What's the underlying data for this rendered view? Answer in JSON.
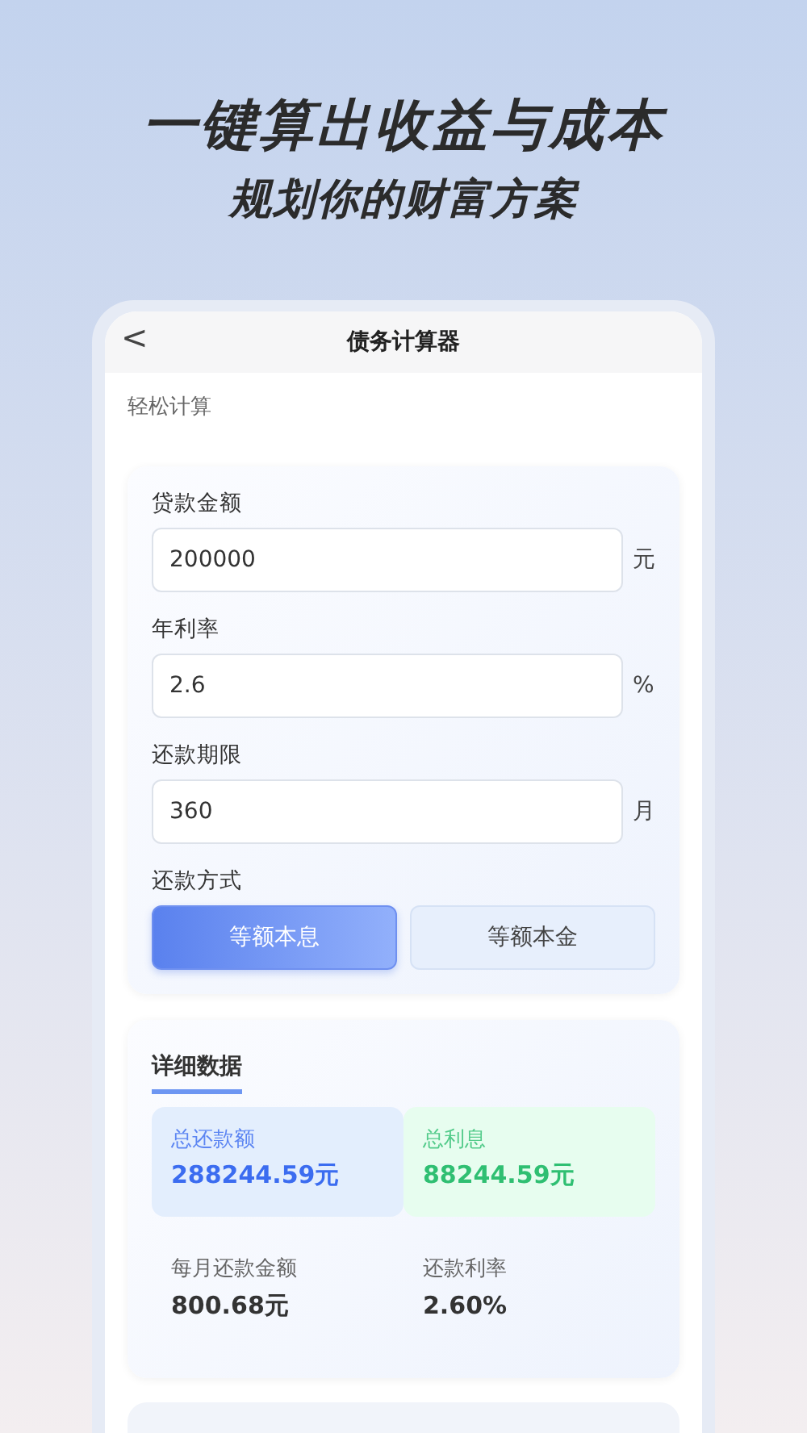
{
  "headline": "一键算出收益与成本",
  "subheadline": "规划你的财富方案",
  "screen": {
    "back": "<",
    "title": "债务计算器",
    "subtitle": "轻松计算"
  },
  "fields": [
    {
      "label": "贷款金额",
      "value": "200000",
      "unit": "元"
    },
    {
      "label": "年利率",
      "value": "2.6",
      "unit": "%"
    },
    {
      "label": "还款期限",
      "value": "360",
      "unit": "月"
    }
  ],
  "method": {
    "label": "还款方式",
    "options": [
      {
        "label": "等额本息",
        "selected": true
      },
      {
        "label": "等额本金",
        "selected": false
      }
    ]
  },
  "details": {
    "title": "详细数据",
    "highlights": [
      {
        "label": "总还款额",
        "value": "288244.59元",
        "color": "#3b6cf0"
      },
      {
        "label": "总利息",
        "value": "88244.59元",
        "color": "#2fbf72"
      }
    ],
    "stats": [
      {
        "label": "每月还款金额",
        "value": "800.68元"
      },
      {
        "label": "还款利率",
        "value": "2.60%"
      }
    ]
  }
}
